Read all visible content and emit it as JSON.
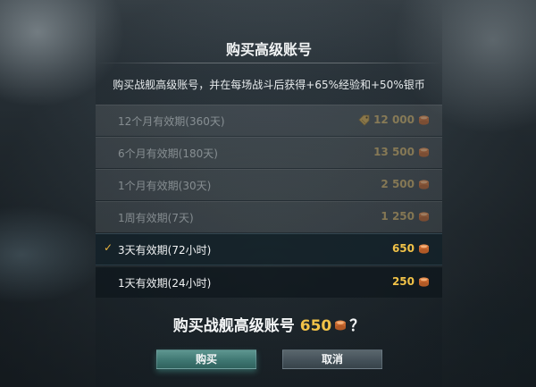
{
  "dialog": {
    "title": "购买高级账号",
    "description": "购买战舰高级账号，并在每场战斗后获得+65%经验和+50%银币"
  },
  "options": [
    {
      "label": "12个月有效期(360天)",
      "price": "12 000",
      "state": "disabled",
      "has_discount_icon": true
    },
    {
      "label": "6个月有效期(180天)",
      "price": "13 500",
      "state": "disabled",
      "has_discount_icon": false
    },
    {
      "label": "1个月有效期(30天)",
      "price": "2 500",
      "state": "disabled",
      "has_discount_icon": false
    },
    {
      "label": "1周有效期(7天)",
      "price": "1 250",
      "state": "disabled",
      "has_discount_icon": false
    },
    {
      "label": "3天有效期(72小时)",
      "price": "650",
      "state": "selected",
      "has_discount_icon": false
    },
    {
      "label": "1天有效期(24小时)",
      "price": "250",
      "state": "enabled",
      "has_discount_icon": false
    }
  ],
  "question": {
    "text": "购买战舰高级账号",
    "amount": "650",
    "suffix": "？"
  },
  "buttons": {
    "buy": "购买",
    "cancel": "取消"
  },
  "icons": {
    "currency": "doubloon-icon",
    "discount": "discount-tag-icon",
    "selected": "checkmark-icon"
  },
  "colors": {
    "price_gold": "#f1c248",
    "check_orange": "#e8b33e",
    "buy_button": "#3f7772"
  }
}
